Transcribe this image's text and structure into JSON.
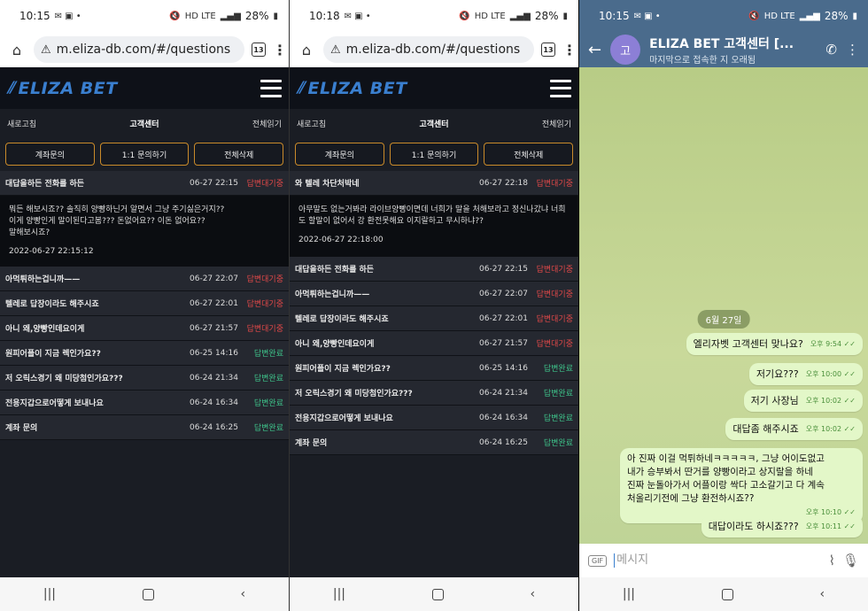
{
  "panel1": {
    "status": {
      "time": "10:15",
      "net": "HD LTE",
      "battery": "28%"
    },
    "url": "m.eliza-db.com/#/questions",
    "tabs": "13",
    "logo": "ELIZA BET",
    "subnav": {
      "left": "새로고침",
      "mid": "고객센터",
      "right": "전체읽기"
    },
    "buttons": [
      "계좌문의",
      "1:1 문의하기",
      "전체삭제"
    ],
    "rows_top": [
      {
        "title": "대답을하든 전화를 하든",
        "date": "06-27 22:15",
        "status": "답변대기중",
        "state": "wait"
      }
    ],
    "detail": {
      "text": "뭐든 해보시죠?? 솔직히 양빵하닌거 알면서 그냥 주기싫은거지??\n이게 양빵인게 말이된다고봄??? 돈없어요?? 이돈 없어요??\n말해보시죠?",
      "ts": "2022-06-27 22:15:12"
    },
    "rows": [
      {
        "title": "아먹튀하는겁니까——",
        "date": "06-27 22:07",
        "status": "답변대기중",
        "state": "wait"
      },
      {
        "title": "텔레로 답장이라도 해주시죠",
        "date": "06-27 22:01",
        "status": "답변대기중",
        "state": "wait"
      },
      {
        "title": "아니 왜,양빵인데요이게",
        "date": "06-27 21:57",
        "status": "답변대기중",
        "state": "wait"
      },
      {
        "title": "원피어플이 지금 렉인가요??",
        "date": "06-25 14:16",
        "status": "답변완료",
        "state": "done"
      },
      {
        "title": "저 오릭스경기 왜 미당첨인가요???",
        "date": "06-24 21:34",
        "status": "답변완료",
        "state": "done"
      },
      {
        "title": "전용지갑으로어떻게 보내나요",
        "date": "06-24 16:34",
        "status": "답변완료",
        "state": "done"
      },
      {
        "title": "계좌 문의",
        "date": "06-24 16:25",
        "status": "답변완료",
        "state": "done"
      }
    ]
  },
  "panel2": {
    "status": {
      "time": "10:18",
      "net": "HD LTE",
      "battery": "28%"
    },
    "url": "m.eliza-db.com/#/questions",
    "tabs": "13",
    "logo": "ELIZA BET",
    "subnav": {
      "left": "새로고침",
      "mid": "고객센터",
      "right": "전체읽기"
    },
    "buttons": [
      "계좌문의",
      "1:1 문의하기",
      "전체삭제"
    ],
    "rows_top": [
      {
        "title": "와 텔레 차단처박네",
        "date": "06-27 22:18",
        "status": "답변대기중",
        "state": "wait"
      }
    ],
    "detail": {
      "text": "아무말도 없는거봐라 라이브양빵이면데 너희가 말을 처해보라고 정신나갔냐 너희도 할말이 없어서 강 환전못해요 이지랄하고 무시하냐??",
      "ts": "2022-06-27 22:18:00"
    },
    "rows": [
      {
        "title": "대답을하든 전화를 하든",
        "date": "06-27 22:15",
        "status": "답변대기중",
        "state": "wait"
      },
      {
        "title": "아먹튀하는겁니까——",
        "date": "06-27 22:07",
        "status": "답변대기중",
        "state": "wait"
      },
      {
        "title": "텔레로 답장이라도 해주시죠",
        "date": "06-27 22:01",
        "status": "답변대기중",
        "state": "wait"
      },
      {
        "title": "아니 왜,양빵인데요이게",
        "date": "06-27 21:57",
        "status": "답변대기중",
        "state": "wait"
      },
      {
        "title": "원피어플이 지금 렉인가요??",
        "date": "06-25 14:16",
        "status": "답변완료",
        "state": "done"
      },
      {
        "title": "저 오릭스경기 왜 미당첨인가요???",
        "date": "06-24 21:34",
        "status": "답변완료",
        "state": "done"
      },
      {
        "title": "전용지갑으로어떻게 보내나요",
        "date": "06-24 16:34",
        "status": "답변완료",
        "state": "done"
      },
      {
        "title": "계좌 문의",
        "date": "06-24 16:25",
        "status": "답변완료",
        "state": "done"
      }
    ]
  },
  "panel3": {
    "status": {
      "time": "10:15",
      "net": "HD LTE",
      "battery": "28%"
    },
    "avatar": "고",
    "name": "ELIZA BET 고객센터 [...",
    "sub": "마지막으로 접속한 지 오래됨",
    "day": "6월 27일",
    "messages": [
      {
        "text": "엘리자벳 고객센터 맞나요?",
        "time": "오후 9:54"
      },
      {
        "text": "저기요???",
        "time": "오후 10:00"
      },
      {
        "text": "저기 사장님",
        "time": "오후 10:02"
      },
      {
        "text": "대답좀 해주시죠",
        "time": "오후 10:02"
      },
      {
        "text": "아 진짜 이걸 먹튀하네ㅋㅋㅋㅋㅋ, 그냥 어이도없고\n내가 승부봐서 딴거를 양빵이라고 상지랄을 하네\n진짜 눈돌아가서 어플이랑 싹다 고소갈기고 다 계속\n처올리기전에 그냥 환전하시죠??",
        "time": "오후 10:10"
      },
      {
        "text": "대답이라도 하시죠???",
        "time": "오후 10:11"
      }
    ],
    "placeholder": "메시지",
    "gif": "GIF"
  }
}
